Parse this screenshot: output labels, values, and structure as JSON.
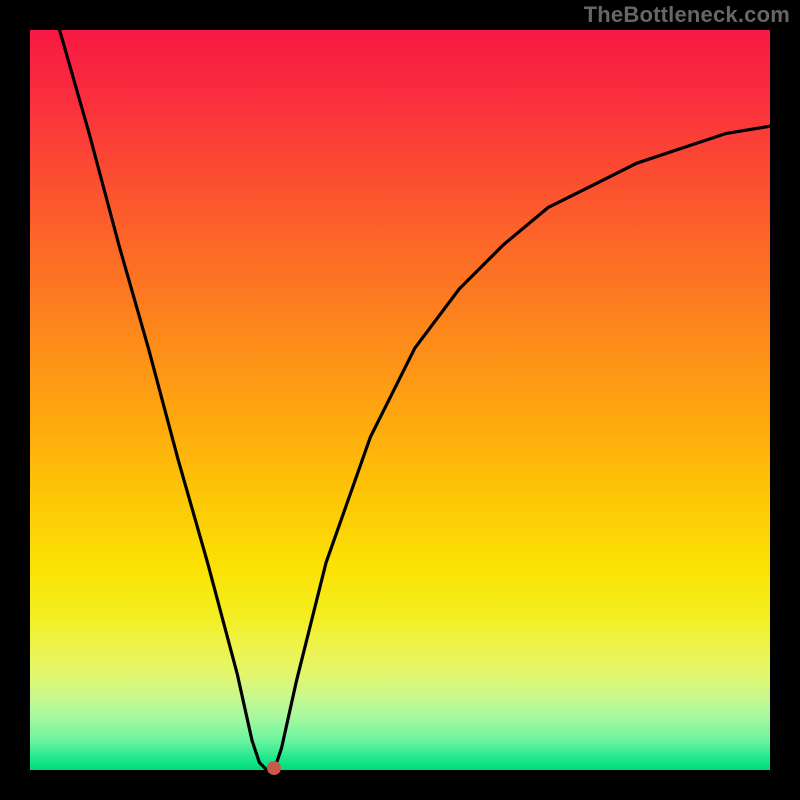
{
  "watermark": "TheBottleneck.com",
  "chart_data": {
    "type": "line",
    "title": "",
    "xlabel": "",
    "ylabel": "",
    "xlim": [
      0,
      100
    ],
    "ylim": [
      0,
      100
    ],
    "grid": false,
    "series": [
      {
        "name": "bottleneck-curve",
        "x": [
          4,
          8,
          12,
          16,
          20,
          24,
          28,
          30,
          31,
          32,
          33,
          34,
          36,
          40,
          46,
          52,
          58,
          64,
          70,
          76,
          82,
          88,
          94,
          100
        ],
        "y": [
          100,
          86,
          71,
          57,
          42,
          28,
          13,
          4,
          1,
          0,
          0,
          3,
          12,
          28,
          45,
          57,
          65,
          71,
          76,
          79,
          82,
          84,
          86,
          87
        ]
      }
    ],
    "marker": {
      "x": 33,
      "y": 0,
      "name": "optimal-point"
    },
    "background_gradient": {
      "top": "#f81944",
      "bottom": "#00db75",
      "description": "red-orange-yellow-green vertical gradient"
    }
  }
}
